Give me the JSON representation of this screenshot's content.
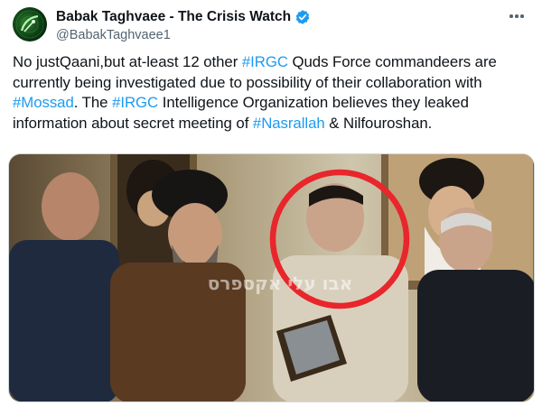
{
  "author": {
    "display_name": "Babak Taghvaee - The Crisis Watch",
    "handle": "@BabakTaghvaee1",
    "verified_color": "#1d9bf0",
    "avatar_icon": "satellite-dish-icon"
  },
  "menu_icon": "more-options-icon",
  "tweet": {
    "lines": [
      [
        {
          "text": "No justQaani,but at-least 12 other ",
          "tag": false
        },
        {
          "text": "#IRGC",
          "tag": true
        },
        {
          "text": " Quds Force commandeers are",
          "tag": false
        }
      ],
      [
        {
          "text": "currently being investigated due to possibility of their collaboration with",
          "tag": false
        }
      ],
      [
        {
          "text": "#Mossad",
          "tag": true
        },
        {
          "text": ". The ",
          "tag": false
        },
        {
          "text": "#IRGC",
          "tag": true
        },
        {
          "text": " Intelligence Organization believes they leaked",
          "tag": false
        }
      ],
      [
        {
          "text": "information about secret meeting of ",
          "tag": false
        },
        {
          "text": "#Nasrallah",
          "tag": true
        },
        {
          "text": " & Nilfouroshan.",
          "tag": false
        }
      ]
    ]
  },
  "media": {
    "watermark": "אבו עלי אקספרס",
    "highlight_color": "#e8262b",
    "link_color": "#1d9bf0"
  }
}
